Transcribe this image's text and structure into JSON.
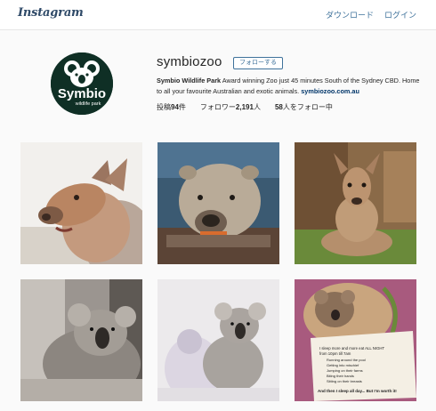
{
  "header": {
    "logo": "Instagram",
    "download_link": "ダウンロード",
    "login_link": "ログイン"
  },
  "profile": {
    "avatar_text_main": "Symbio",
    "avatar_text_sub": "wildlife park",
    "username": "symbiozoo",
    "follow_label": "フォローする",
    "bio_name": "Symbio Wildlife Park",
    "bio_text": " Award winning Zoo just 45 minutes South of the Sydney CBD. Home to all your favourite Australian and exotic animals. ",
    "bio_link": "symbiozoo.com.au",
    "stats": {
      "posts_prefix": "投稿",
      "posts_count": "94",
      "posts_suffix": "件",
      "followers_prefix": "フォロワー",
      "followers_count": "2,191",
      "followers_suffix": "人",
      "following_count": "58",
      "following_suffix": "人をフォロー中"
    }
  },
  "posts": [
    {
      "subject": "wallaby"
    },
    {
      "subject": "wombat"
    },
    {
      "subject": "kangaroo"
    },
    {
      "subject": "koala"
    },
    {
      "subject": "koala-joey-with-toy"
    },
    {
      "subject": "koala-in-bag"
    }
  ],
  "post6_note": {
    "line1": "I sleep more and more eat ALL NIGHT",
    "line2": "from 10pm till 7am",
    "items": [
      "Running around the pool",
      "Getting into mischief",
      "Jumping on their farms",
      "Biting their hands",
      "Sitting on their breasts"
    ],
    "footer": "And then I sleep all day... But I'm worth it!"
  },
  "colors": {
    "link": "#3f729b",
    "logo": "#2f4a68",
    "avatar_bg": "#0f2f25"
  }
}
